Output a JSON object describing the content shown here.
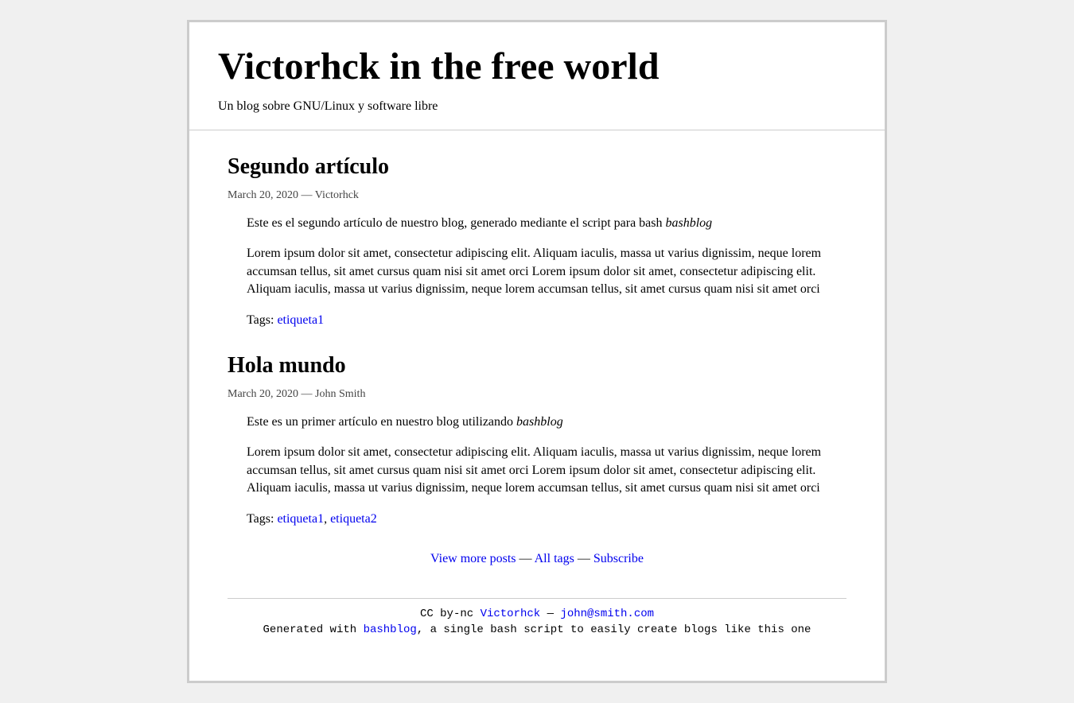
{
  "header": {
    "title": "Victorhck in the free world",
    "subtitle": "Un blog sobre GNU/Linux y software libre"
  },
  "posts": [
    {
      "title": "Segundo artículo",
      "meta": "March 20, 2020 — Victorhck",
      "intro_prefix": "Este es el segundo artículo de nuestro blog, generado mediante el script para bash ",
      "intro_em": "bashblog",
      "body": "Lorem ipsum dolor sit amet, consectetur adipiscing elit. Aliquam iaculis, massa ut varius dignissim, neque lorem accumsan tellus, sit amet cursus quam nisi sit amet orci Lorem ipsum dolor sit amet, consectetur adipiscing elit. Aliquam iaculis, massa ut varius dignissim, neque lorem accumsan tellus, sit amet cursus quam nisi sit amet orci",
      "tags_label": "Tags: ",
      "tags": [
        "etiqueta1"
      ]
    },
    {
      "title": "Hola mundo",
      "meta": "March 20, 2020 — John Smith",
      "intro_prefix": "Este es un primer artículo en nuestro blog utilizando ",
      "intro_em": "bashblog",
      "body": "Lorem ipsum dolor sit amet, consectetur adipiscing elit. Aliquam iaculis, massa ut varius dignissim, neque lorem accumsan tellus, sit amet cursus quam nisi sit amet orci Lorem ipsum dolor sit amet, consectetur adipiscing elit. Aliquam iaculis, massa ut varius dignissim, neque lorem accumsan tellus, sit amet cursus quam nisi sit amet orci",
      "tags_label": "Tags: ",
      "tags": [
        "etiqueta1",
        "etiqueta2"
      ]
    }
  ],
  "nav": {
    "view_more": "View more posts",
    "all_tags": "All tags",
    "subscribe": "Subscribe",
    "sep": " — "
  },
  "footer": {
    "cc": "CC by-nc ",
    "author": "Victorhck",
    "sep": " — ",
    "email": "john@smith.com",
    "gen_prefix": "Generated with ",
    "gen_link": "bashblog",
    "gen_suffix": ", a single bash script to easily create blogs like this one"
  }
}
